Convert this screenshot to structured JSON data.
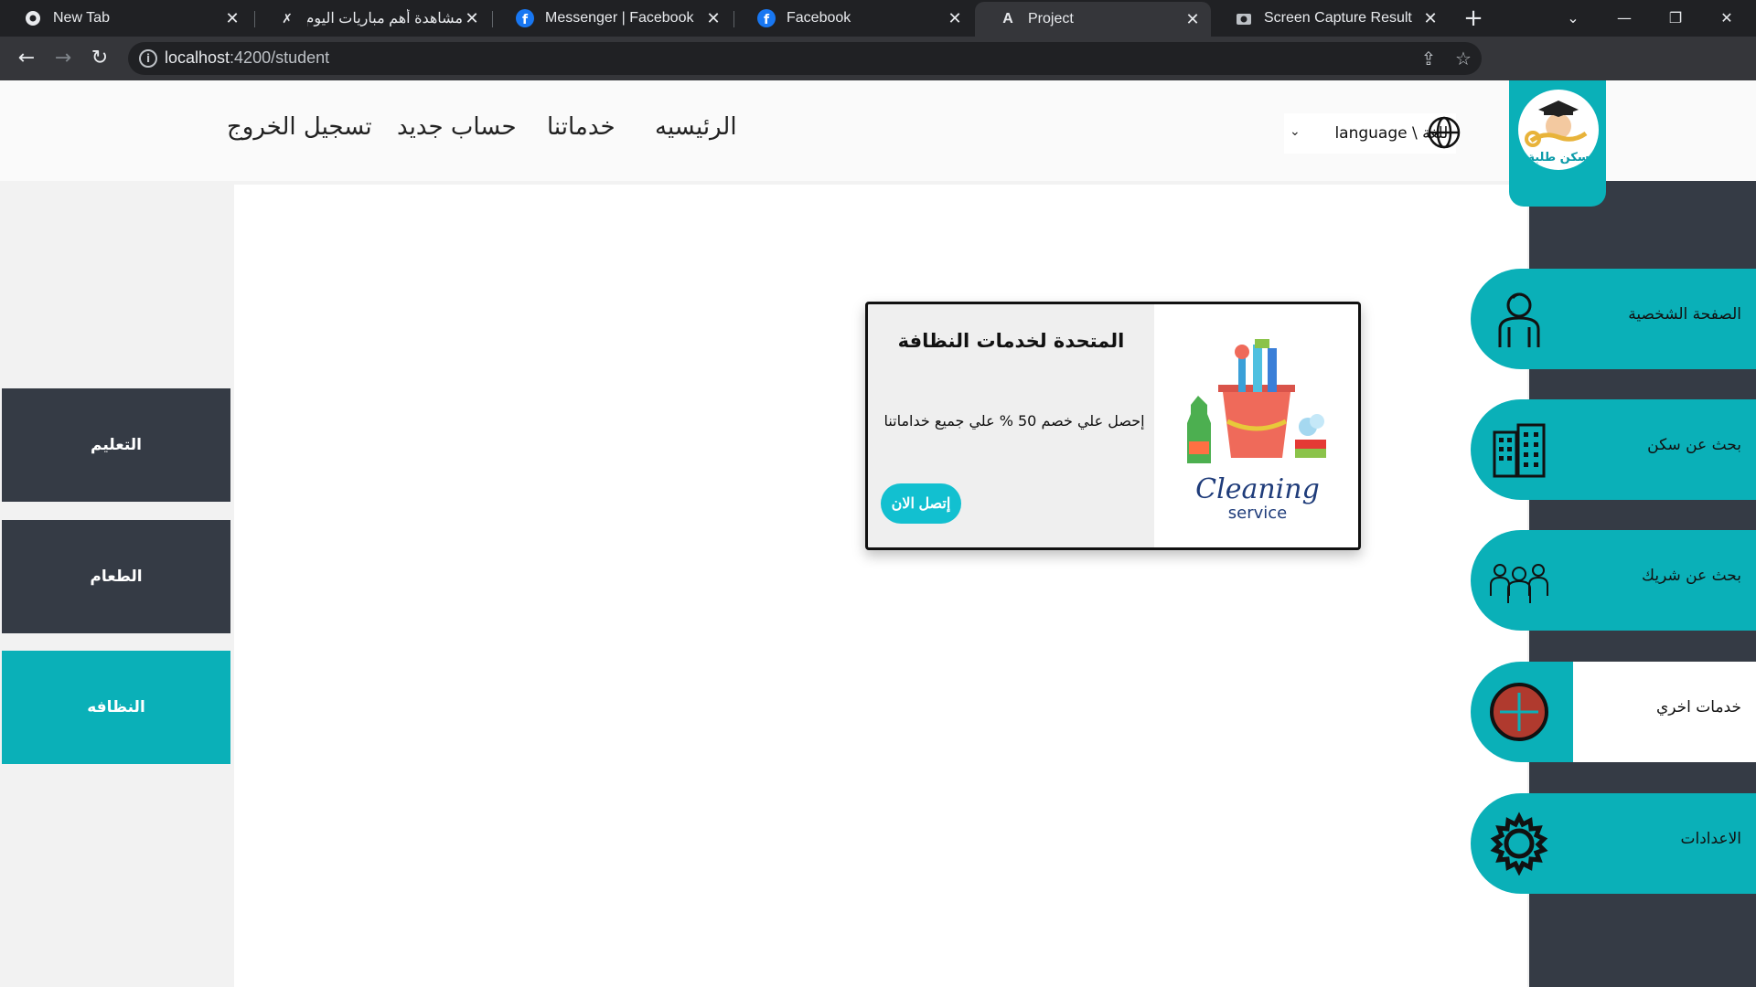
{
  "browser": {
    "tabs": [
      {
        "title": "New Tab",
        "icon": "chrome-icon"
      },
      {
        "title": "مشاهدة أهم مباريات اليوم | ..",
        "icon": "site-icon"
      },
      {
        "title": "Messenger | Facebook",
        "icon": "facebook-icon"
      },
      {
        "title": "Facebook",
        "icon": "facebook-icon"
      },
      {
        "title": "Project",
        "icon": "angular-icon",
        "active": true
      },
      {
        "title": "Screen Capture Result",
        "icon": "camera-icon"
      }
    ],
    "url_host": "localhost",
    "url_path": ":4200/student"
  },
  "header": {
    "nav": {
      "home": "الرئيسيه",
      "services": "خدماتنا",
      "register": "حساب جديد",
      "logout": "تسجيل الخروج"
    },
    "language_label": "language \\ اللغة",
    "logo_text": "سكن طلبة"
  },
  "left_menu": [
    {
      "label": "التعليم",
      "active": false
    },
    {
      "label": "الطعام",
      "active": false
    },
    {
      "label": "النظافه",
      "active": true
    }
  ],
  "right_menu": [
    {
      "label": "الصفحة الشخصية",
      "icon": "person-icon"
    },
    {
      "label": "بحث عن سكن",
      "icon": "building-icon"
    },
    {
      "label": "بحث عن شريك",
      "icon": "group-icon"
    },
    {
      "label": "خدمات اخري",
      "icon": "plus-circle-icon",
      "active": true
    },
    {
      "label": "الاعدادات",
      "icon": "gear-icon"
    }
  ],
  "card": {
    "title": "المتحدة لخدمات النظافة",
    "text": "إحصل علي خصم 50 % علي جميع خداماتنا",
    "button": "إتصل الان",
    "image_text_1": "Cleaning",
    "image_text_2": "service"
  },
  "colors": {
    "accent": "#0ab0b8",
    "dark": "#353b45",
    "button": "#12c0d0"
  }
}
